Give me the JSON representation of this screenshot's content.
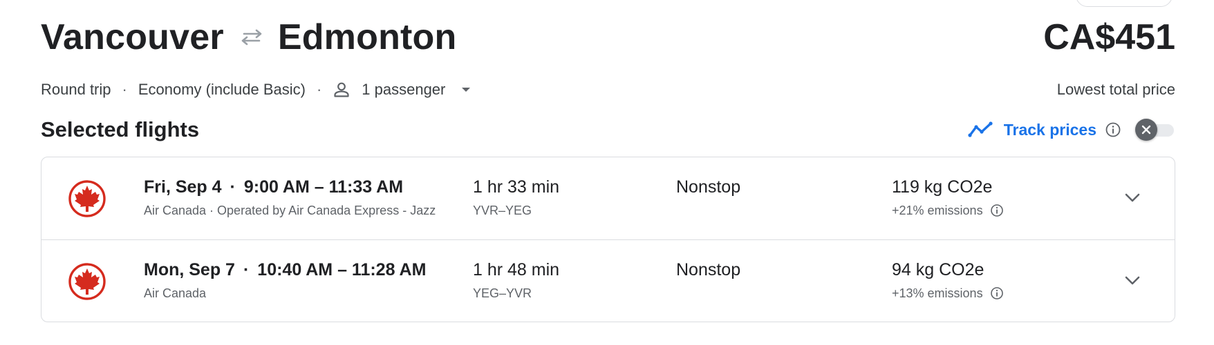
{
  "route": {
    "origin": "Vancouver",
    "destination": "Edmonton"
  },
  "trip": {
    "type": "Round trip",
    "cabin": "Economy (include Basic)",
    "passengers": "1 passenger"
  },
  "price": {
    "value": "CA$451",
    "label": "Lowest total price"
  },
  "selected": {
    "title": "Selected flights",
    "track_label": "Track prices",
    "track_enabled": false
  },
  "flights": [
    {
      "airline_logo": "air-canada-maple-leaf",
      "date": "Fri, Sep 4",
      "times": "9:00 AM – 11:33 AM",
      "carrier": "Air Canada · Operated by Air Canada Express - Jazz",
      "duration": "1 hr 33 min",
      "airports": "YVR–YEG",
      "stops": "Nonstop",
      "co2": "119 kg CO2e",
      "emissions": "+21% emissions"
    },
    {
      "airline_logo": "air-canada-maple-leaf",
      "date": "Mon, Sep 7",
      "times": "10:40 AM – 11:28 AM",
      "carrier": "Air Canada",
      "duration": "1 hr 48 min",
      "airports": "YEG–YVR",
      "stops": "Nonstop",
      "co2": "94 kg CO2e",
      "emissions": "+13% emissions"
    }
  ],
  "colors": {
    "accent": "#1a73e8",
    "airline_red": "#d52b1e",
    "text_primary": "#202124",
    "text_secondary": "#5f6368",
    "border": "#dadce0"
  }
}
